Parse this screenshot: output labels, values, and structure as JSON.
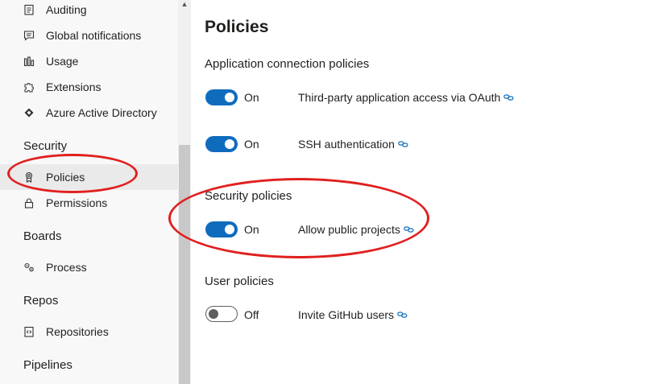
{
  "sidebar": {
    "items_top": [
      {
        "label": "Auditing",
        "icon": "clipboard-icon"
      },
      {
        "label": "Global notifications",
        "icon": "chat-icon"
      },
      {
        "label": "Usage",
        "icon": "bar-chart-icon"
      },
      {
        "label": "Extensions",
        "icon": "puzzle-icon"
      },
      {
        "label": "Azure Active Directory",
        "icon": "azure-ad-icon"
      }
    ],
    "security": {
      "heading": "Security",
      "items": [
        {
          "label": "Policies",
          "icon": "badge-icon",
          "selected": true
        },
        {
          "label": "Permissions",
          "icon": "lock-icon"
        }
      ]
    },
    "boards": {
      "heading": "Boards",
      "items": [
        {
          "label": "Process",
          "icon": "gears-icon"
        }
      ]
    },
    "repos": {
      "heading": "Repos",
      "items": [
        {
          "label": "Repositories",
          "icon": "code-file-icon"
        }
      ]
    },
    "pipelines": {
      "heading": "Pipelines"
    }
  },
  "main": {
    "title": "Policies",
    "groups": [
      {
        "title": "Application connection policies",
        "policies": [
          {
            "state": "On",
            "enabled": true,
            "label": "Third-party application access via OAuth"
          },
          {
            "state": "On",
            "enabled": true,
            "label": "SSH authentication"
          }
        ]
      },
      {
        "title": "Security policies",
        "policies": [
          {
            "state": "On",
            "enabled": true,
            "label": "Allow public projects"
          }
        ]
      },
      {
        "title": "User policies",
        "policies": [
          {
            "state": "Off",
            "enabled": false,
            "label": "Invite GitHub users"
          }
        ]
      }
    ]
  },
  "colors": {
    "accent": "#0f6cbd",
    "annotation": "#e0201f",
    "link_icon": "#0f6cbd"
  }
}
